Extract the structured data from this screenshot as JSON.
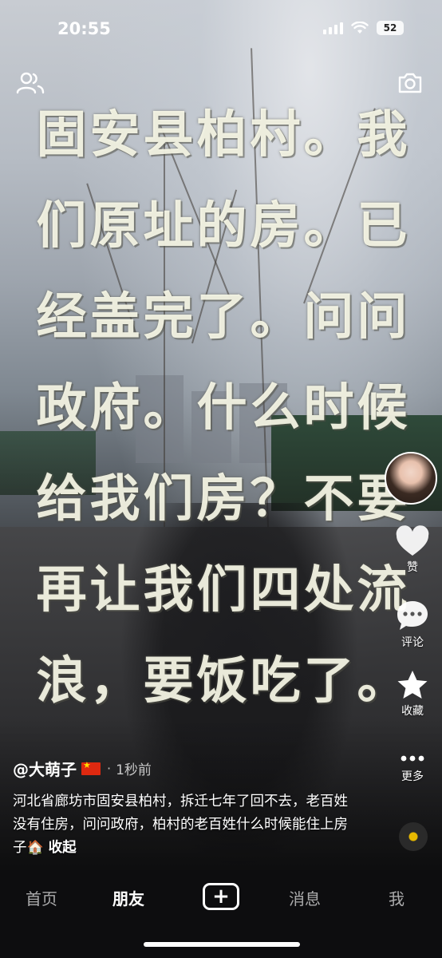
{
  "status_bar": {
    "time": "20:55",
    "battery": "52"
  },
  "top_bar": {
    "left_icon": "friends-icon",
    "right_icon": "camera-icon"
  },
  "video": {
    "overlay_caption": "固安县柏村。我们原址的房。已经盖完了。问问政府。什么时候给我们房？不要再让我们四处流浪，要饭吃了。"
  },
  "side_rail": {
    "like_label": "赞",
    "comment_label": "评论",
    "favorite_label": "收藏",
    "more_label": "更多"
  },
  "post": {
    "author": "@大萌子",
    "separator": "·",
    "time_ago": "1秒前",
    "description": "河北省廊坊市固安县柏村，拆迁七年了回不去，老百姓没有住房，问问政府，柏村的老百姓什么时候能住上房子",
    "emoji": "🏠",
    "collapse_label": "收起"
  },
  "bottom_nav": {
    "home": "首页",
    "friends": "朋友",
    "messages": "消息",
    "me": "我",
    "active": "friends"
  }
}
